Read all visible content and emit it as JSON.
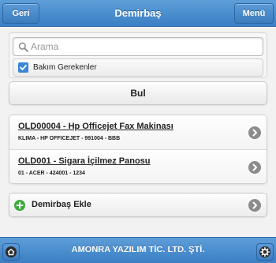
{
  "header": {
    "title": "Demirbaş",
    "back_label": "Geri",
    "menu_label": "Menü"
  },
  "search": {
    "placeholder": "Arama",
    "value": ""
  },
  "filter": {
    "checkbox_label": "Bakım Gerekenler",
    "checked": true
  },
  "actions": {
    "search_button_label": "Bul",
    "add_button_label": "Demirbaş Ekle"
  },
  "items": [
    {
      "title": "OLD00004 - Hp Officejet Fax Makinası",
      "subtitle": "KLIMA - HP OFFICEJET - 991004 - BBB"
    },
    {
      "title": "OLD001 - Sigara İçilmez Panosu",
      "subtitle": "01 - ACER - 424001 - 1234"
    }
  ],
  "footer": {
    "title": "AMONRA YAZILIM TİC. LTD. ŞTİ."
  },
  "icons": {
    "back": "back-button",
    "menu": "menu-button",
    "search": "search-icon",
    "checkbox": "checkbox-icon",
    "chevron": "chevron-right-icon",
    "add": "plus-icon",
    "home": "home-icon",
    "settings": "gear-icon"
  },
  "colors": {
    "bar": "#3a7fc4",
    "add_icon": "#3daa3d",
    "checkbox": "#3a87d6"
  }
}
